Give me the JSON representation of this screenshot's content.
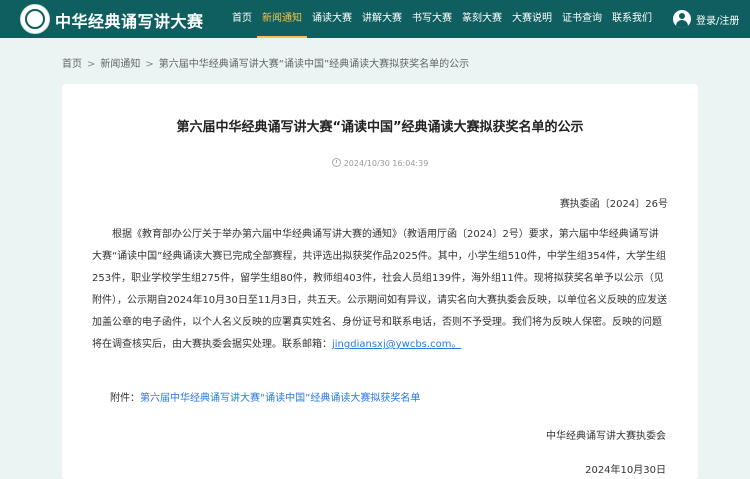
{
  "header": {
    "site_title": "中华经典诵写讲大赛",
    "nav": [
      "首页",
      "新闻通知",
      "诵读大赛",
      "讲解大赛",
      "书写大赛",
      "篆刻大赛",
      "大赛说明",
      "证书查询",
      "联系我们"
    ],
    "active_nav": "新闻通知",
    "user_label": "登录/注册"
  },
  "breadcrumb": {
    "home": "首页",
    "section": "新闻通知",
    "current": "第六届中华经典诵写讲大赛“诵读中国”经典诵读大赛拟获奖名单的公示",
    "separator": ">"
  },
  "article": {
    "title": "第六届中华经典诵写讲大赛“诵读中国”经典诵读大赛拟获奖名单的公示",
    "datetime": "2024/10/30 16:04:39",
    "doc_number": "赛执委函〔2024〕26号",
    "body": "根据《教育部办公厅关于举办第六届中华经典诵写讲大赛的通知》（教语用厅函〔2024〕2号）要求，第六届中华经典诵写讲大赛“诵读中国”经典诵读大赛已完成全部赛程，共评选出拟获奖作品2025件。其中，小学生组510件，中学生组354件，大学生组253件，职业学校学生组275件，留学生组80件，教师组403件，社会人员组139件，海外组11件。现将拟获奖名单予以公示（见附件），公示期自2024年10月30日至11月3日，共五天。公示期间如有异议，请实名向大赛执委会反映，以单位名义反映的应发送加盖公章的电子函件，以个人名义反映的应署真实姓名、身份证号和联系电话，否则不予受理。我们将为反映人保密。反映的问题将在调查核实后，由大赛执委会据实处理。联系邮箱：",
    "email": "jingdiansxj@ywcbs.com。",
    "attachment_label": "附件：",
    "attachment_link": "第六届中华经典诵写讲大赛“诵读中国”经典诵读大赛拟获奖名单",
    "signer": "中华经典诵写讲大赛执委会",
    "date": "2024年10月30日"
  },
  "colors": {
    "header_bg": "#0f5f60",
    "active_nav": "#f3c24a",
    "page_bg": "#eaf4f3",
    "link": "#2a7ae2"
  }
}
